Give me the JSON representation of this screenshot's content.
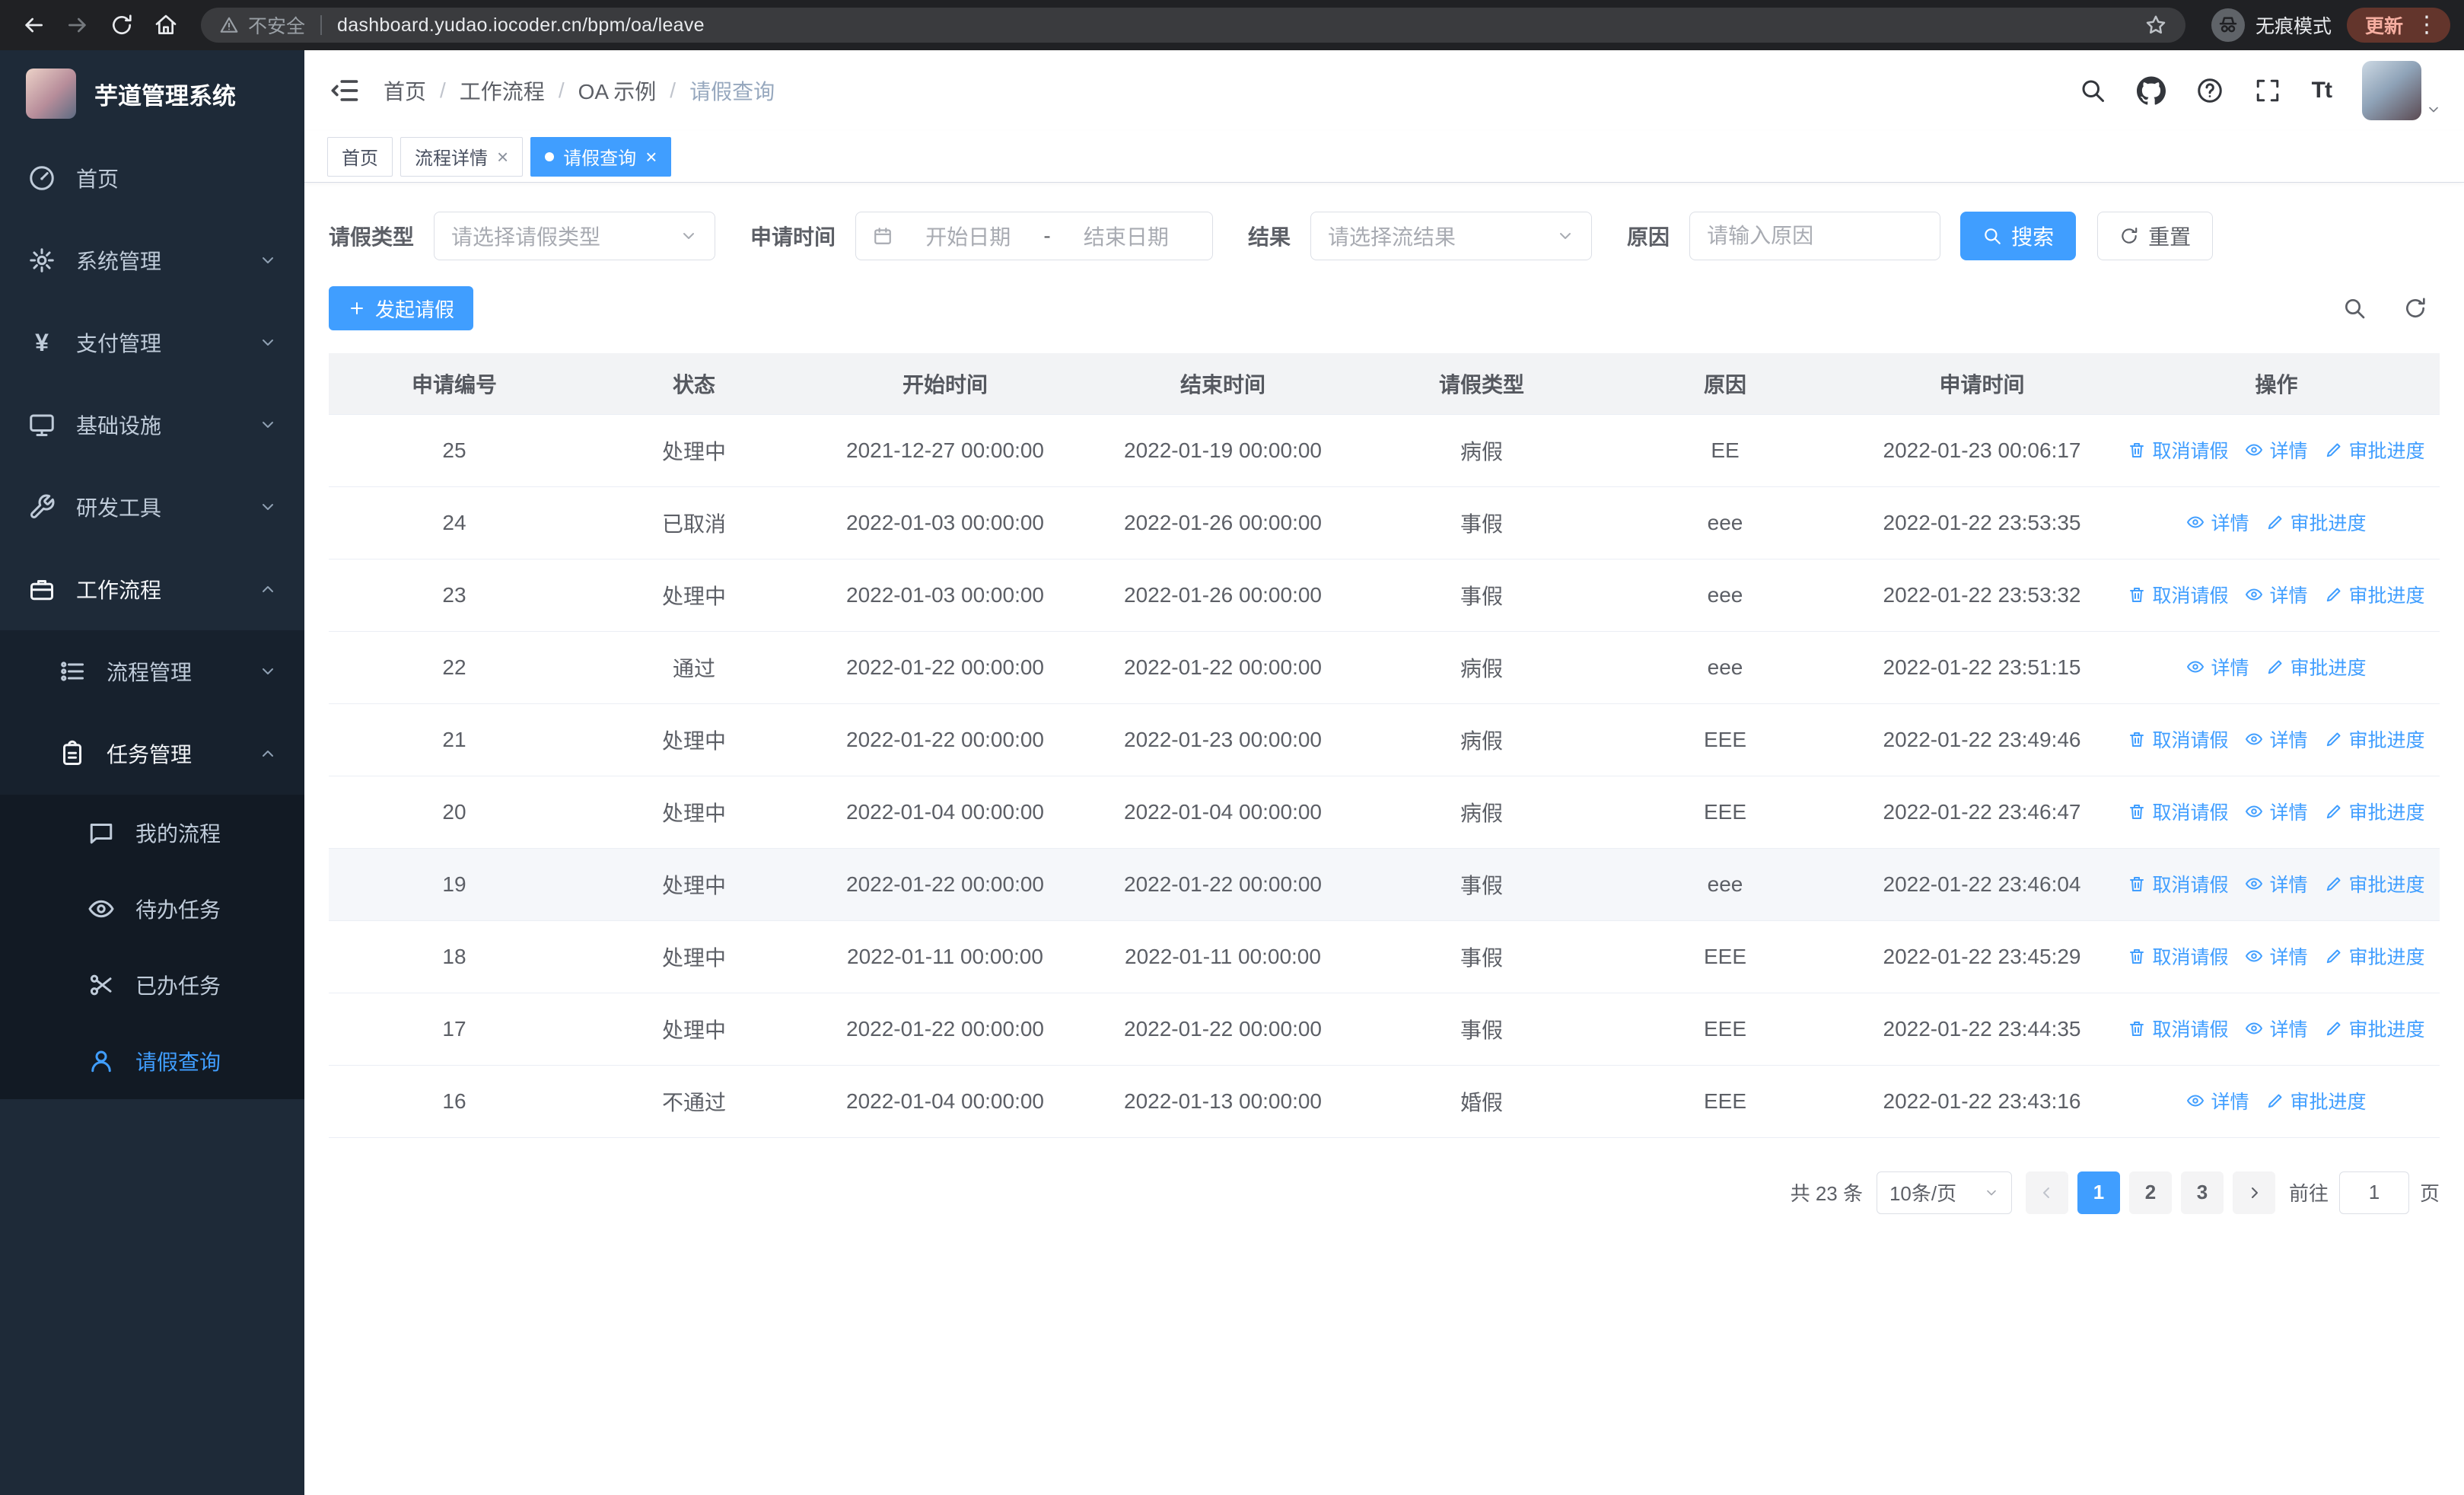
{
  "colors": {
    "accent": "#409eff",
    "sidebar_bg": "#1e2a38",
    "chrome_bg": "#202124",
    "active_tab_bg": "#409eff"
  },
  "glyphs": {
    "kebab": "⋮",
    "close": "×",
    "yen": "¥",
    "font_size_icon": "Tt",
    "breadcrumb_separator": "/"
  },
  "browser": {
    "security_warning": "不安全",
    "url": "dashboard.yudao.iocoder.cn/bpm/oa/leave",
    "incognito_label": "无痕模式",
    "update_button": "更新"
  },
  "sidebar": {
    "app_title": "芋道管理系统",
    "menu": [
      {
        "label": "首页"
      },
      {
        "label": "系统管理"
      },
      {
        "label": "支付管理"
      },
      {
        "label": "基础设施"
      },
      {
        "label": "研发工具"
      },
      {
        "label": "工作流程"
      },
      {
        "label": "流程管理"
      },
      {
        "label": "任务管理"
      },
      {
        "label": "我的流程"
      },
      {
        "label": "待办任务"
      },
      {
        "label": "已办任务"
      },
      {
        "label": "请假查询"
      }
    ]
  },
  "header": {
    "breadcrumb": [
      "首页",
      "工作流程",
      "OA 示例",
      "请假查询"
    ]
  },
  "tabs": [
    {
      "label": "首页",
      "closable": false,
      "active": false
    },
    {
      "label": "流程详情",
      "closable": true,
      "active": false
    },
    {
      "label": "请假查询",
      "closable": true,
      "active": true
    }
  ],
  "filters": {
    "leave_type_label": "请假类型",
    "leave_type_placeholder": "请选择请假类型",
    "apply_time_label": "申请时间",
    "start_date_placeholder": "开始日期",
    "range_separator": "-",
    "end_date_placeholder": "结束日期",
    "result_label": "结果",
    "result_placeholder": "请选择流结果",
    "reason_label": "原因",
    "reason_placeholder": "请输入原因",
    "search_button": "搜索",
    "reset_button": "重置"
  },
  "toolbar": {
    "create_button": "发起请假"
  },
  "table": {
    "headers": [
      "申请编号",
      "状态",
      "开始时间",
      "结束时间",
      "请假类型",
      "原因",
      "申请时间",
      "操作"
    ],
    "actions": {
      "cancel": "取消请假",
      "detail": "详情",
      "progress": "审批进度"
    },
    "rows": [
      {
        "id": "25",
        "status": "处理中",
        "start": "2021-12-27 00:00:00",
        "end": "2022-01-19 00:00:00",
        "type": "病假",
        "reason": "EE",
        "applied": "2022-01-23 00:06:17",
        "can_cancel": true,
        "highlighted": false
      },
      {
        "id": "24",
        "status": "已取消",
        "start": "2022-01-03 00:00:00",
        "end": "2022-01-26 00:00:00",
        "type": "事假",
        "reason": "eee",
        "applied": "2022-01-22 23:53:35",
        "can_cancel": false,
        "highlighted": false
      },
      {
        "id": "23",
        "status": "处理中",
        "start": "2022-01-03 00:00:00",
        "end": "2022-01-26 00:00:00",
        "type": "事假",
        "reason": "eee",
        "applied": "2022-01-22 23:53:32",
        "can_cancel": true,
        "highlighted": false
      },
      {
        "id": "22",
        "status": "通过",
        "start": "2022-01-22 00:00:00",
        "end": "2022-01-22 00:00:00",
        "type": "病假",
        "reason": "eee",
        "applied": "2022-01-22 23:51:15",
        "can_cancel": false,
        "highlighted": false
      },
      {
        "id": "21",
        "status": "处理中",
        "start": "2022-01-22 00:00:00",
        "end": "2022-01-23 00:00:00",
        "type": "病假",
        "reason": "EEE",
        "applied": "2022-01-22 23:49:46",
        "can_cancel": true,
        "highlighted": false
      },
      {
        "id": "20",
        "status": "处理中",
        "start": "2022-01-04 00:00:00",
        "end": "2022-01-04 00:00:00",
        "type": "病假",
        "reason": "EEE",
        "applied": "2022-01-22 23:46:47",
        "can_cancel": true,
        "highlighted": false
      },
      {
        "id": "19",
        "status": "处理中",
        "start": "2022-01-22 00:00:00",
        "end": "2022-01-22 00:00:00",
        "type": "事假",
        "reason": "eee",
        "applied": "2022-01-22 23:46:04",
        "can_cancel": true,
        "highlighted": true
      },
      {
        "id": "18",
        "status": "处理中",
        "start": "2022-01-11 00:00:00",
        "end": "2022-01-11 00:00:00",
        "type": "事假",
        "reason": "EEE",
        "applied": "2022-01-22 23:45:29",
        "can_cancel": true,
        "highlighted": false
      },
      {
        "id": "17",
        "status": "处理中",
        "start": "2022-01-22 00:00:00",
        "end": "2022-01-22 00:00:00",
        "type": "事假",
        "reason": "EEE",
        "applied": "2022-01-22 23:44:35",
        "can_cancel": true,
        "highlighted": false
      },
      {
        "id": "16",
        "status": "不通过",
        "start": "2022-01-04 00:00:00",
        "end": "2022-01-13 00:00:00",
        "type": "婚假",
        "reason": "EEE",
        "applied": "2022-01-22 23:43:16",
        "can_cancel": false,
        "highlighted": false
      }
    ]
  },
  "pagination": {
    "total_text": "共 23 条",
    "page_size": "10条/页",
    "pages": [
      "1",
      "2",
      "3"
    ],
    "current_page": "1",
    "goto_label": "前往",
    "goto_value": "1",
    "page_suffix": "页"
  }
}
